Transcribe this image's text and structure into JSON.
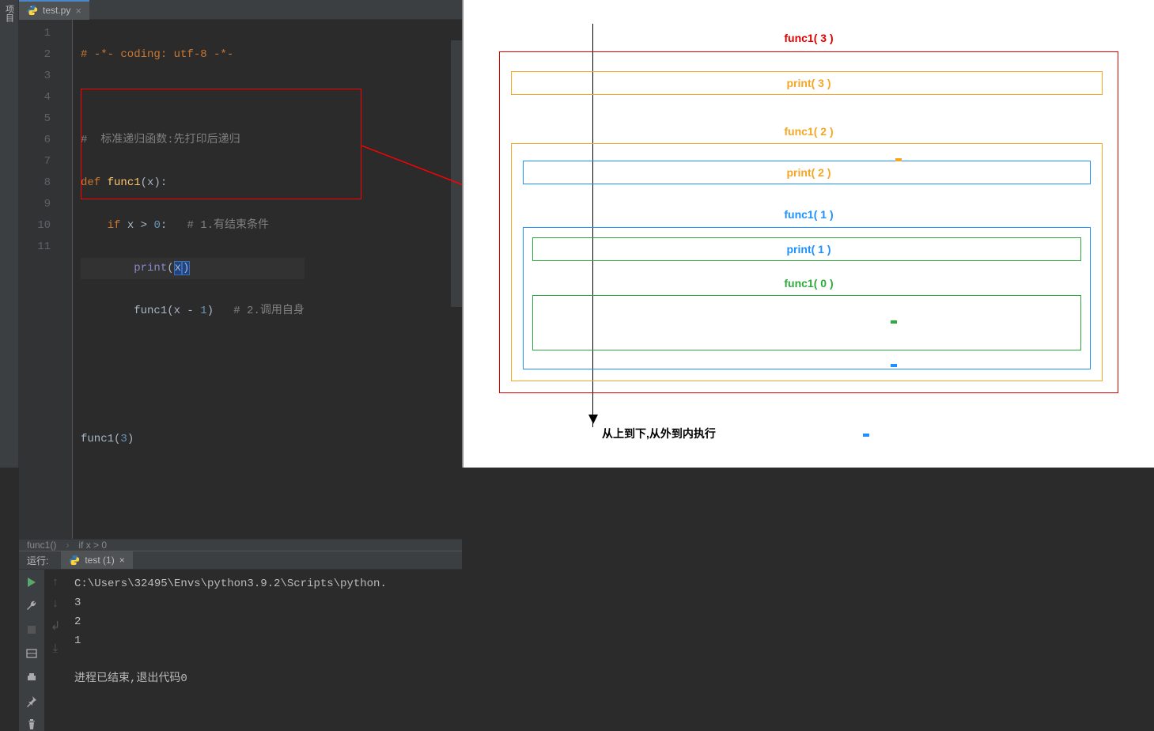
{
  "sidebar": {
    "label": "项目"
  },
  "tab": {
    "filename": "test.py"
  },
  "line_numbers": [
    "1",
    "2",
    "3",
    "4",
    "5",
    "6",
    "7",
    "8",
    "9",
    "10",
    "11"
  ],
  "code": {
    "l1_coding": "# -*- coding: utf-8 -*-",
    "l3_comment": "#  标准递归函数:先打印后递归",
    "l4_def": "def ",
    "l4_name": "func1",
    "l4_par": "(x):",
    "l5_if": "if ",
    "l5_cond": "x > ",
    "l5_zero": "0",
    "l5_colon": ":   ",
    "l5_comment": "# 1.有结束条件",
    "l6_print": "print",
    "l6_args_open": "(",
    "l6_x": "x",
    "l6_args_close": ")",
    "l7_call": "func1(x - ",
    "l7_one": "1",
    "l7_close": ")   ",
    "l7_comment": "# 2.调用自身",
    "l10_call": "func1(",
    "l10_arg": "3",
    "l10_close": ")"
  },
  "breadcrumb": {
    "a": "func1()",
    "b": "if x > 0"
  },
  "run": {
    "label": "运行:",
    "tab": "test (1)",
    "path": "C:\\Users\\32495\\Envs\\python3.9.2\\Scripts\\python.",
    "out1": "3",
    "out2": "2",
    "out3": "1",
    "exit": "进程已结束,退出代码0"
  },
  "diagram": {
    "f3": "func1( 3 )",
    "p3": "print( 3 )",
    "f2": "func1( 2 )",
    "p2": "print( 2 )",
    "f1": "func1( 1 )",
    "p1": "print( 1 )",
    "f0": "func1( 0 )",
    "footer": "从上到下,从外到内执行"
  }
}
